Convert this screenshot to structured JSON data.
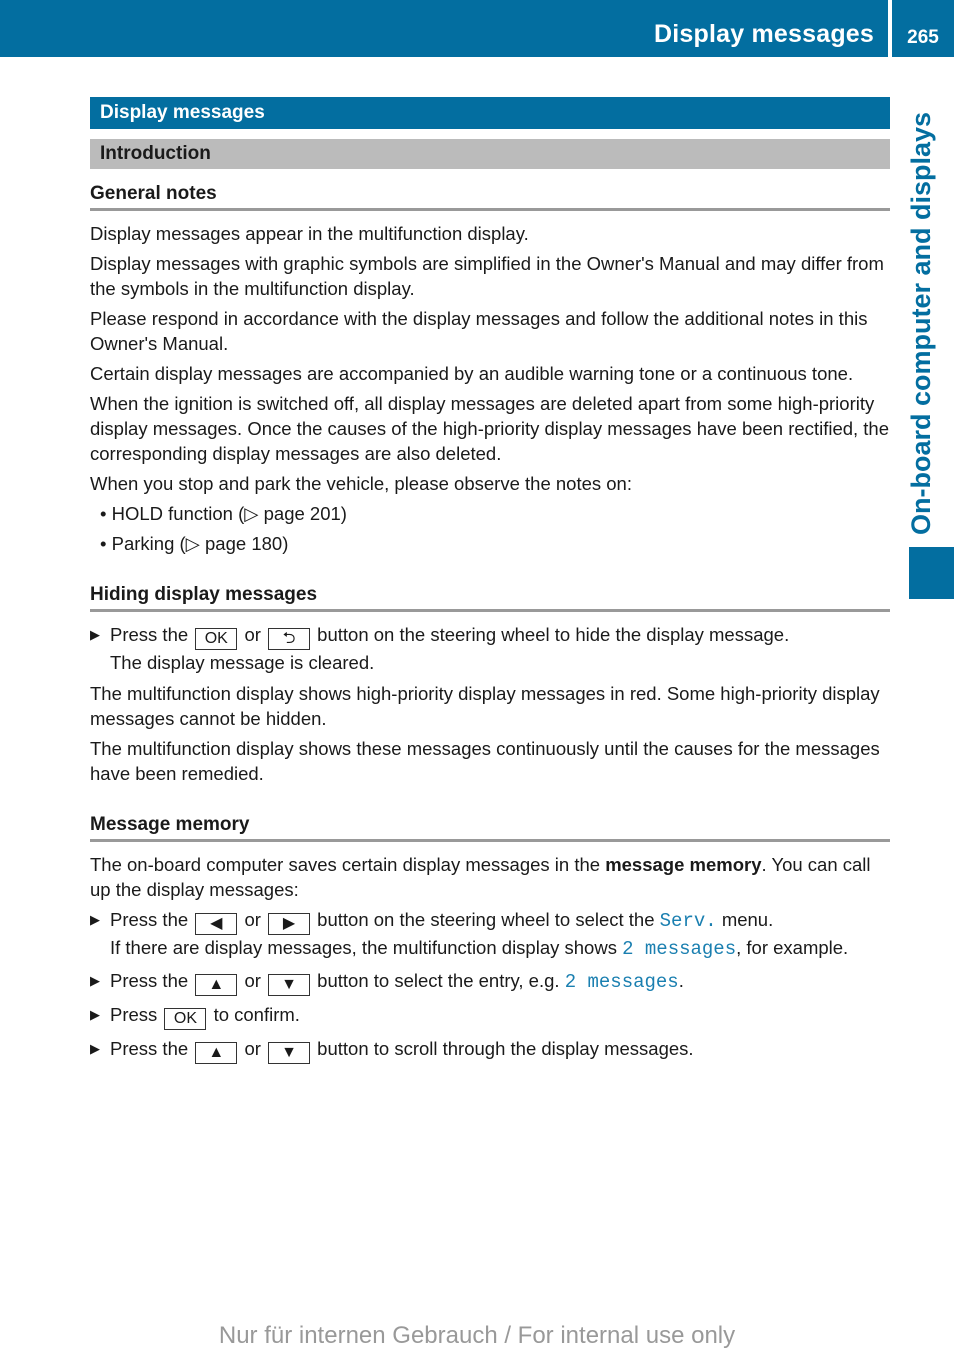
{
  "header": {
    "title": "Display messages",
    "page": "265"
  },
  "side_label": "On-board computer and displays",
  "section": {
    "title": "Display messages",
    "subtitle": "Introduction"
  },
  "general_notes": {
    "heading": "General notes",
    "paragraphs": [
      "Display messages appear in the multifunction display.",
      "Display messages with graphic symbols are simplified in the Owner's Manual and may differ from the symbols in the multifunction display.",
      "Please respond in accordance with the display messages and follow the additional notes in this Owner's Manual.",
      "Certain display messages are accompanied by an audible warning tone or a continuous tone.",
      "When the ignition is switched off, all display messages are deleted apart from some high-priority display messages. Once the causes of the high-priority display messages have been rectified, the corresponding display messages are also deleted.",
      "When you stop and park the vehicle, please observe the notes on:"
    ],
    "bullets": [
      {
        "text": "HOLD function (",
        "ref": "▷ page 201",
        "close": ")"
      },
      {
        "text": "Parking (",
        "ref": "▷ page 180",
        "close": ")"
      }
    ]
  },
  "hiding": {
    "heading": "Hiding display messages",
    "step": {
      "pre": "Press the",
      "key1": "OK",
      "or": "or",
      "key2": "⮌",
      "post": "button on the steering wheel to hide the display message.",
      "result": "The display message is cleared."
    },
    "paragraphs": [
      "The multifunction display shows high-priority display messages in red. Some high-priority display messages cannot be hidden.",
      "The multifunction display shows these messages continuously until the causes for the messages have been remedied."
    ]
  },
  "memory": {
    "heading": "Message memory",
    "intro_pre": "The on-board computer saves certain display messages in the ",
    "intro_bold": "message memory",
    "intro_post": ". You can call up the display messages:",
    "steps": {
      "s1": {
        "pre": "Press the",
        "k1": "◀",
        "or": "or",
        "k2": "▶",
        "mid": "button on the steering wheel to select the",
        "disp": "Serv.",
        "post": "menu.",
        "r_pre": "If there are display messages, the multifunction display shows",
        "r_disp": "2 messages",
        "r_post": ", for example."
      },
      "s2": {
        "pre": "Press the",
        "k1": "▲",
        "or": "or",
        "k2": "▼",
        "mid": "button to select the entry, e.g.",
        "disp": "2 messages",
        "post": "."
      },
      "s3": {
        "pre": "Press",
        "k1": "OK",
        "post": "to confirm."
      },
      "s4": {
        "pre": "Press the",
        "k1": "▲",
        "or": "or",
        "k2": "▼",
        "post": "button to scroll through the display messages."
      }
    }
  },
  "footer": "Nur für internen Gebrauch / For internal use only",
  "icons": {
    "step_arrow": "▶"
  }
}
